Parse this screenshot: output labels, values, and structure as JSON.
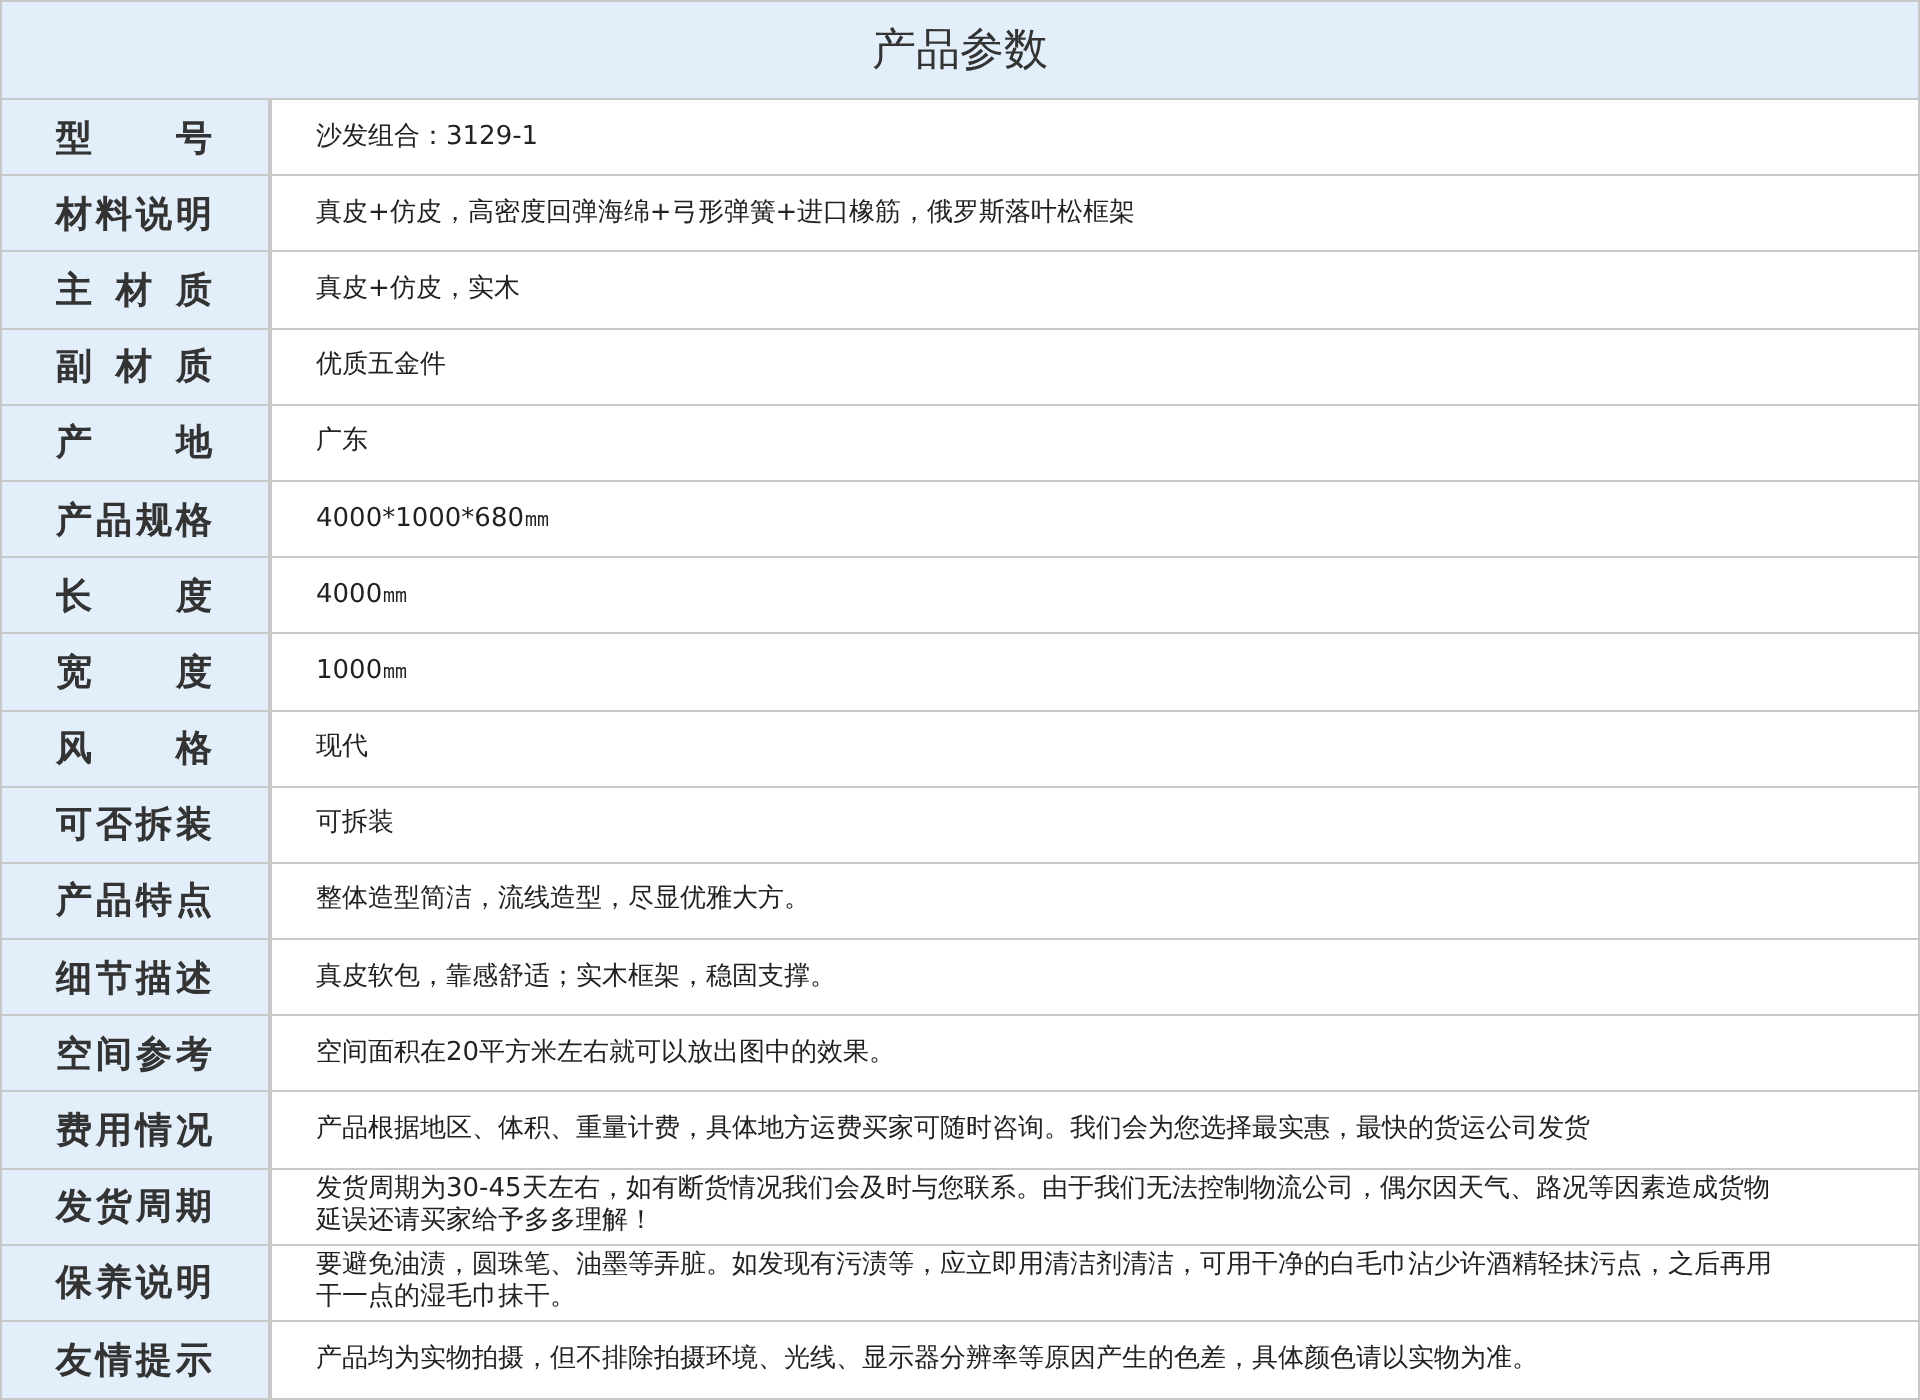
{
  "title": "产品参数",
  "rows": [
    {
      "label": "型号",
      "value": "沙发组合：3129-1"
    },
    {
      "label": "材料说明",
      "value": "真皮+仿皮，高密度回弹海绵+弓形弹簧+进口橡筋，俄罗斯落叶松框架"
    },
    {
      "label": "主材质",
      "value": "真皮+仿皮，实木"
    },
    {
      "label": "副材质",
      "value": "优质五金件"
    },
    {
      "label": "产地",
      "value": "广东"
    },
    {
      "label": "产品规格",
      "value": "4000*1000*680㎜"
    },
    {
      "label": "长度",
      "value": "4000㎜"
    },
    {
      "label": "宽度",
      "value": "1000㎜"
    },
    {
      "label": "风格",
      "value": "现代"
    },
    {
      "label": "可否拆装",
      "value": "可拆装"
    },
    {
      "label": "产品特点",
      "value": "整体造型简洁，流线造型，尽显优雅大方。"
    },
    {
      "label": "细节描述",
      "value": "真皮软包，靠感舒适；实木框架，稳固支撑。"
    },
    {
      "label": "空间参考",
      "value": "空间面积在20平方米左右就可以放出图中的效果。"
    },
    {
      "label": "费用情况",
      "value": "产品根据地区、体积、重量计费，具体地方运费买家可随时咨询。我们会为您选择最实惠，最快的货运公司发货"
    },
    {
      "label": "发货周期",
      "value": "发货周期为30-45天左右，如有断货情况我们会及时与您联系。由于我们无法控制物流公司，偶尔因天气、路况等因素造成货物延误还请买家给予多多理解！"
    },
    {
      "label": "保养说明",
      "value": "要避免油渍，圆珠笔、油墨等弄脏。如发现有污渍等，应立即用清洁剂清洁，可用干净的白毛巾沾少许酒精轻抹污点，之后再用干一点的湿毛巾抹干。"
    },
    {
      "label": "友情提示",
      "value": "产品均为实物拍摄，但不排除拍摄环境、光线、显示器分辨率等原因产生的色差，具体颜色请以实物为准。"
    }
  ]
}
